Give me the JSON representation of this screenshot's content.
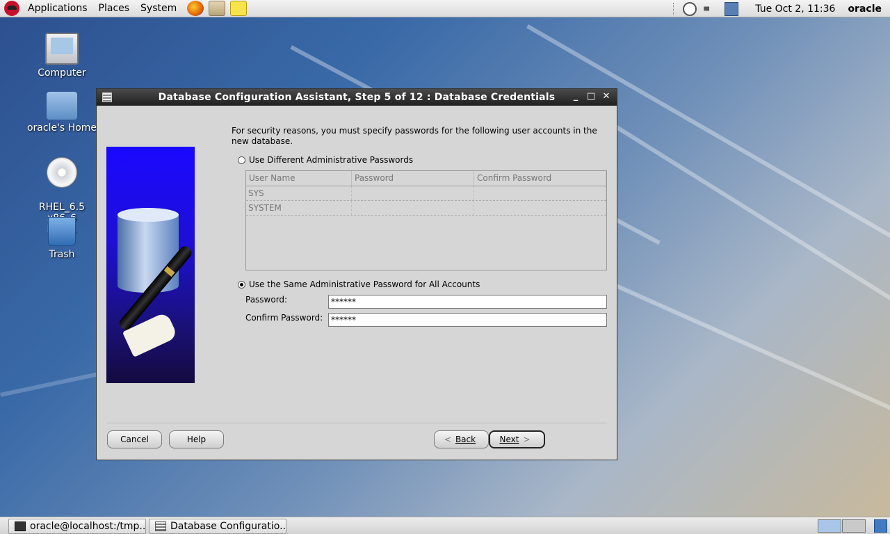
{
  "top_panel": {
    "menus": [
      "Applications",
      "Places",
      "System"
    ],
    "clock": "Tue Oct  2, 11:36",
    "user": "oracle"
  },
  "desktop_icons": [
    {
      "label": "Computer"
    },
    {
      "label": "oracle's Home"
    },
    {
      "label": "RHEL_6.5 x86_6\nDisc 1"
    },
    {
      "label": "Trash"
    }
  ],
  "dialog": {
    "title": "Database Configuration Assistant, Step 5 of 12 : Database Credentials",
    "intro": "For security reasons, you must specify passwords for the following user accounts in the new database.",
    "option_different": "Use Different Administrative Passwords",
    "table": {
      "headers": [
        "User Name",
        "Password",
        "Confirm Password"
      ],
      "rows": [
        [
          "SYS",
          "",
          ""
        ],
        [
          "SYSTEM",
          "",
          ""
        ]
      ]
    },
    "option_same": "Use the Same Administrative Password for All Accounts",
    "password_label": "Password:",
    "password_value": "******",
    "confirm_label": "Confirm Password:",
    "confirm_value": "******",
    "buttons": {
      "cancel": "Cancel",
      "help": "Help",
      "back": "Back",
      "next": "Next"
    }
  },
  "taskbar": {
    "tasks": [
      "oracle@localhost:/tmp...",
      "Database Configuratio..."
    ]
  }
}
